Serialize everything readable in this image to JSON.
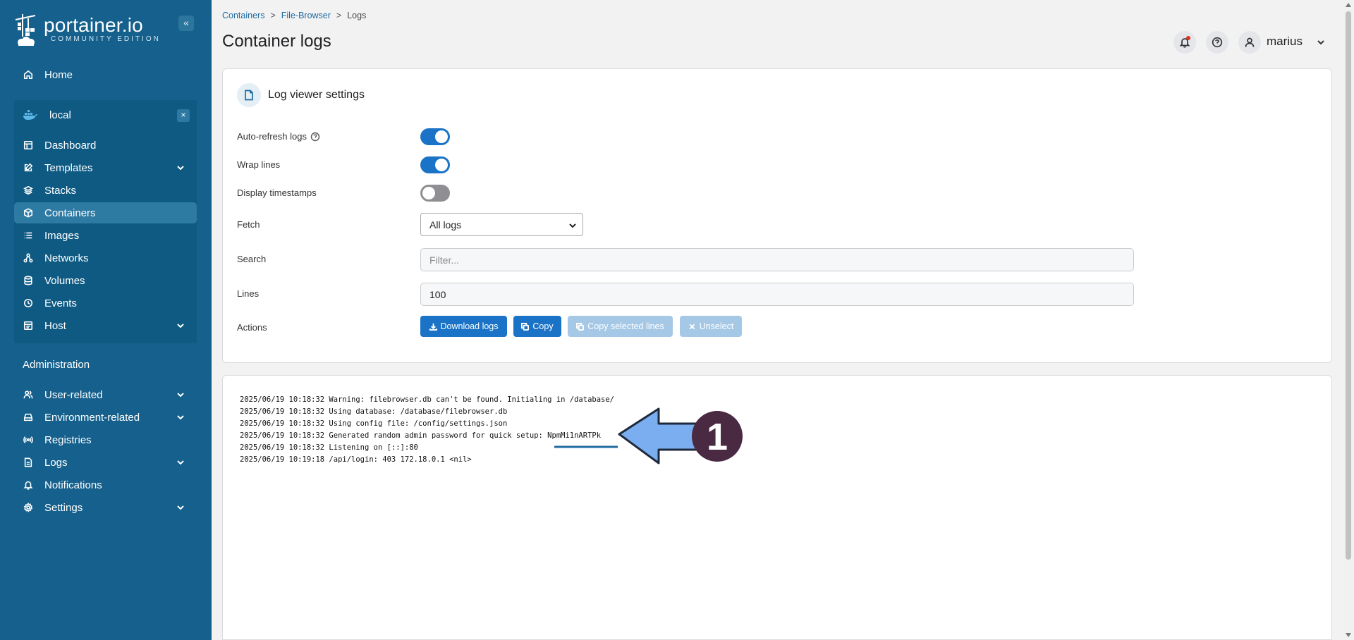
{
  "brand": {
    "title": "portainer.io",
    "subtitle": "COMMUNITY EDITION"
  },
  "sidebar": {
    "collapse_label": "«",
    "home": "Home",
    "environment": {
      "name": "local",
      "close": "×",
      "items": [
        {
          "label": "Dashboard",
          "icon": "dashboard-icon"
        },
        {
          "label": "Templates",
          "icon": "edit-icon",
          "expandable": true
        },
        {
          "label": "Stacks",
          "icon": "layers-icon"
        },
        {
          "label": "Containers",
          "icon": "box-icon",
          "active": true
        },
        {
          "label": "Images",
          "icon": "list-icon"
        },
        {
          "label": "Networks",
          "icon": "network-icon"
        },
        {
          "label": "Volumes",
          "icon": "database-icon"
        },
        {
          "label": "Events",
          "icon": "clock-icon"
        },
        {
          "label": "Host",
          "icon": "host-icon",
          "expandable": true
        }
      ]
    },
    "admin_title": "Administration",
    "admin_items": [
      {
        "label": "User-related",
        "icon": "users-icon",
        "expandable": true
      },
      {
        "label": "Environment-related",
        "icon": "drive-icon",
        "expandable": true
      },
      {
        "label": "Registries",
        "icon": "radio-icon"
      },
      {
        "label": "Logs",
        "icon": "file-icon",
        "expandable": true
      },
      {
        "label": "Notifications",
        "icon": "bell-icon"
      },
      {
        "label": "Settings",
        "icon": "gear-icon",
        "expandable": true
      }
    ]
  },
  "breadcrumb": {
    "items": [
      "Containers",
      "File-Browser",
      "Logs"
    ],
    "separator": ">"
  },
  "header": {
    "title": "Container logs",
    "user": "marius"
  },
  "settings": {
    "title": "Log viewer settings",
    "auto_refresh_label": "Auto-refresh logs",
    "auto_refresh": true,
    "wrap_lines_label": "Wrap lines",
    "wrap_lines": true,
    "timestamps_label": "Display timestamps",
    "timestamps": false,
    "fetch_label": "Fetch",
    "fetch_value": "All logs",
    "search_label": "Search",
    "search_placeholder": "Filter...",
    "lines_label": "Lines",
    "lines_value": "100",
    "actions_label": "Actions",
    "buttons": {
      "download": "Download logs",
      "copy": "Copy",
      "copy_selected": "Copy selected lines",
      "unselect": "Unselect"
    }
  },
  "logs": [
    "2025/06/19 10:18:32 Warning: filebrowser.db can't be found. Initialing in /database/",
    "2025/06/19 10:18:32 Using database: /database/filebrowser.db",
    "2025/06/19 10:18:32 Using config file: /config/settings.json",
    "2025/06/19 10:18:32 Generated random admin password for quick setup: NpmMi1nARTPk",
    "2025/06/19 10:18:32 Listening on [::]:80",
    "2025/06/19 10:19:18 /api/login: 403 172.18.0.1 <nil>"
  ],
  "annotation": {
    "step": "1",
    "colors": {
      "arrow_fill": "#7aaef0",
      "arrow_stroke": "#1d2a3c",
      "badge": "#4a2942",
      "underline": "#1f6ba0"
    }
  },
  "colors": {
    "sidebar": "#15608c",
    "accent": "#1a73c6",
    "active_nav": "#2d7aa3"
  }
}
